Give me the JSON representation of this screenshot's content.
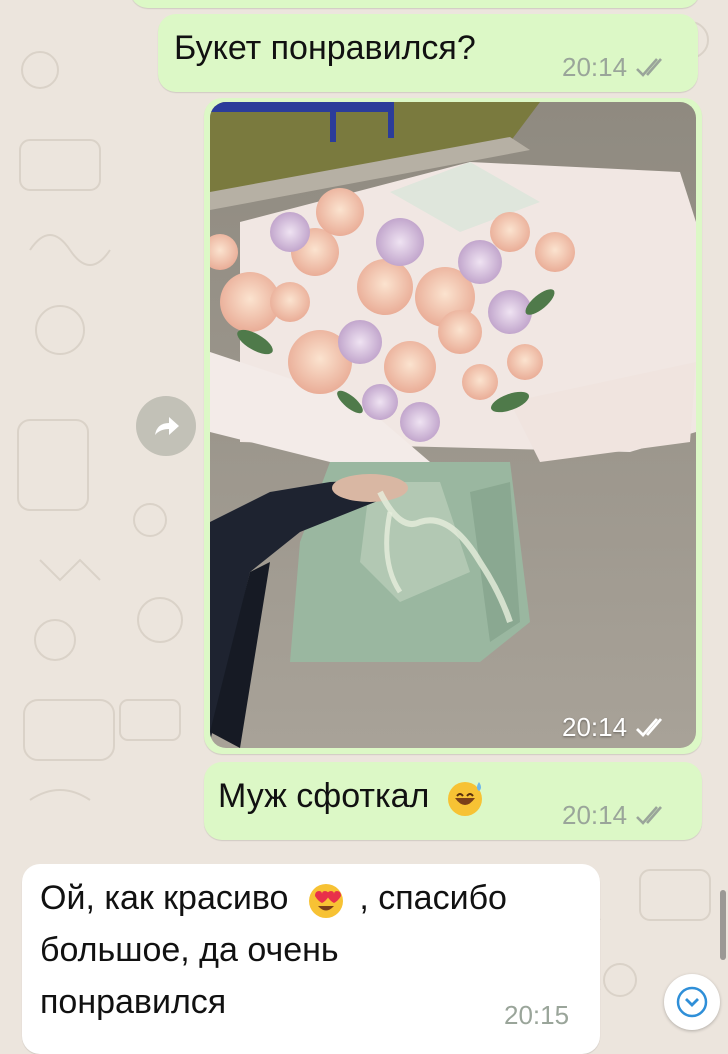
{
  "messages": [
    {
      "text": "Букет понравился?",
      "time": "20:14"
    },
    {
      "photo_time": "20:14"
    },
    {
      "text": "Муж сфоткал",
      "emoji": "sweat-smile-emoji",
      "time": "20:14"
    },
    {
      "line1a": "Ой, как красиво",
      "emoji": "heart-eyes-emoji",
      "line1b": ", спасибо",
      "line2": "большое, да очень",
      "line3": "понравился",
      "time": "20:15"
    }
  ],
  "colors": {
    "outgoing_bubble": "#dcf8c6",
    "incoming_bubble": "#ffffff",
    "wallpaper": "#ece5dd",
    "tick_color": "#9aa59a"
  },
  "icons": {
    "forward": "forward-arrow-icon",
    "scroll_down": "chevron-down-icon",
    "read_ticks": "double-check-icon"
  }
}
